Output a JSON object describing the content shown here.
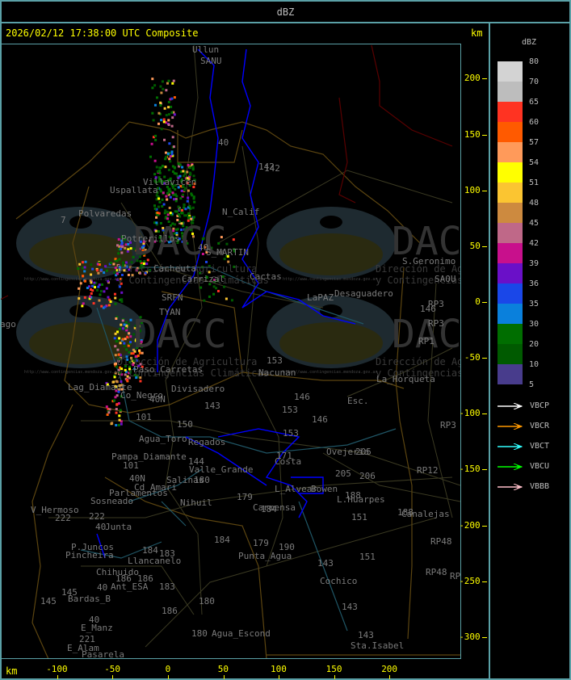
{
  "header": {
    "title": "dBZ"
  },
  "map": {
    "title": "2026/02/12 17:38:00 UTC Composite",
    "unit_right": "km",
    "unit_bottom": "km",
    "x_ticks": [
      "-100",
      "-50",
      "0",
      "50",
      "100",
      "150",
      "200"
    ],
    "y_ticks": [
      "200",
      "150",
      "100",
      "50",
      "0",
      "-50",
      "-100",
      "-150",
      "-200",
      "-250",
      "-300"
    ],
    "watermark": {
      "brand": "DACC",
      "line1": "Dirección de Agricultura",
      "line2": "y Contingencias Climáticas",
      "url": "http://www.contingencias.mendoza.gov.ar"
    },
    "places": [
      "Ullun",
      "SANU",
      "Uspallata",
      "Villavicen",
      "Polvaredas",
      "N_Calif",
      "Potrerillos",
      "S_MARTIN",
      "Cacheuta",
      "Carrizal",
      "Cactas",
      "TYAN",
      "SRFN",
      "Paso_Carretas",
      "Lag_Diamante",
      "Co_Negro",
      "Divisadero",
      "Nacunan",
      "40N",
      "101",
      "143",
      "150",
      "Agua_Toro",
      "Regados",
      "Pampa_Diamante",
      "101",
      "40N",
      "144",
      "Valle_Grande",
      "Salinas",
      "180",
      "Cd_Amari",
      "Parlamentos",
      "Sosneado",
      "Nihuil",
      "V_Hermoso",
      "222",
      "222",
      "40",
      "Junta",
      "P.Juncos",
      "Pincheira",
      "184",
      "Llancanelo",
      "183",
      "Chihuido",
      "186",
      "186",
      "40",
      "Ant_ESA",
      "183",
      "145",
      "Bardas_B",
      "145",
      "180",
      "186",
      "40",
      "E_Manz",
      "221",
      "E_Alam",
      "Pasarela",
      "180",
      "Agua_Escond",
      "179",
      "184",
      "Punta_Agua",
      "179",
      "190",
      "184",
      "Carmensa",
      "L_Alvear",
      "Bowen",
      "L.Huarpes",
      "Ovejeria",
      "205",
      "205",
      "206",
      "188",
      "188",
      "Canalejas",
      "RP48",
      "RP48",
      "RP",
      "151",
      "151",
      "143",
      "Cochico",
      "143",
      "143",
      "Sta.Isabel",
      "RP12",
      "RP3",
      "Esc.",
      "146",
      "153",
      "153",
      "146",
      "153",
      "171",
      "La_Horqueta",
      "Desaguadero",
      "LaPAZ",
      "S.Geronimo",
      "SAOU",
      "146",
      "RP3",
      "RP3",
      "RP1",
      "142",
      "142",
      "40",
      "40",
      "Costa",
      "ago",
      "7"
    ]
  },
  "legend": {
    "title": "dBZ",
    "scale": [
      {
        "label": "80",
        "color": "#d3d3d3"
      },
      {
        "label": "70",
        "color": "#bdbdbd"
      },
      {
        "label": "65",
        "color": "#ff3322"
      },
      {
        "label": "60",
        "color": "#ff5a00"
      },
      {
        "label": "57",
        "color": "#ff9a5a"
      },
      {
        "label": "54",
        "color": "#ffff00"
      },
      {
        "label": "51",
        "color": "#fbc531"
      },
      {
        "label": "48",
        "color": "#cd8a3f"
      },
      {
        "label": "45",
        "color": "#bf6888"
      },
      {
        "label": "42",
        "color": "#c8108c"
      },
      {
        "label": "39",
        "color": "#6a10c8"
      },
      {
        "label": "36",
        "color": "#1a47e8"
      },
      {
        "label": "35",
        "color": "#0a80dc"
      },
      {
        "label": "30",
        "color": "#006e00"
      },
      {
        "label": "20",
        "color": "#005a00"
      },
      {
        "label": "10",
        "color": "#483c8c"
      },
      {
        "label": "5",
        "color": ""
      }
    ],
    "radars": [
      {
        "name": "VBCP",
        "color": "#ffffff"
      },
      {
        "name": "VBCR",
        "color": "#ff9900"
      },
      {
        "name": "VBCT",
        "color": "#33ffff"
      },
      {
        "name": "VBCU",
        "color": "#00ff00"
      },
      {
        "name": "VBBB",
        "color": "#ffc0cb"
      }
    ]
  }
}
